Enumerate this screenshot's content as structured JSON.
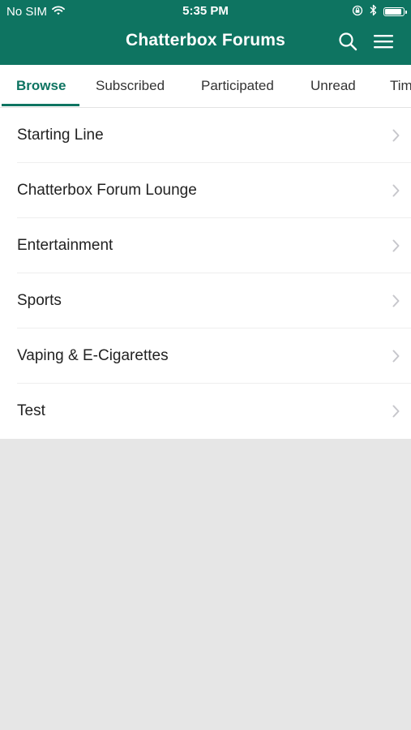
{
  "status_bar": {
    "carrier": "No SIM",
    "time": "5:35 PM",
    "battery_level": 0.9
  },
  "nav": {
    "title": "Chatterbox Forums"
  },
  "tabs": [
    {
      "label": "Browse",
      "active": true
    },
    {
      "label": "Subscribed",
      "active": false
    },
    {
      "label": "Participated",
      "active": false
    },
    {
      "label": "Unread",
      "active": false
    },
    {
      "label": "Timeline",
      "active": false
    }
  ],
  "forums": [
    {
      "label": "Starting Line"
    },
    {
      "label": "Chatterbox Forum Lounge"
    },
    {
      "label": "Entertainment"
    },
    {
      "label": "Sports"
    },
    {
      "label": "Vaping & E-Cigarettes"
    },
    {
      "label": "Test"
    }
  ],
  "colors": {
    "brand": "#0e7461",
    "background": "#e6e6e6",
    "chevron": "#c7c7cc"
  }
}
